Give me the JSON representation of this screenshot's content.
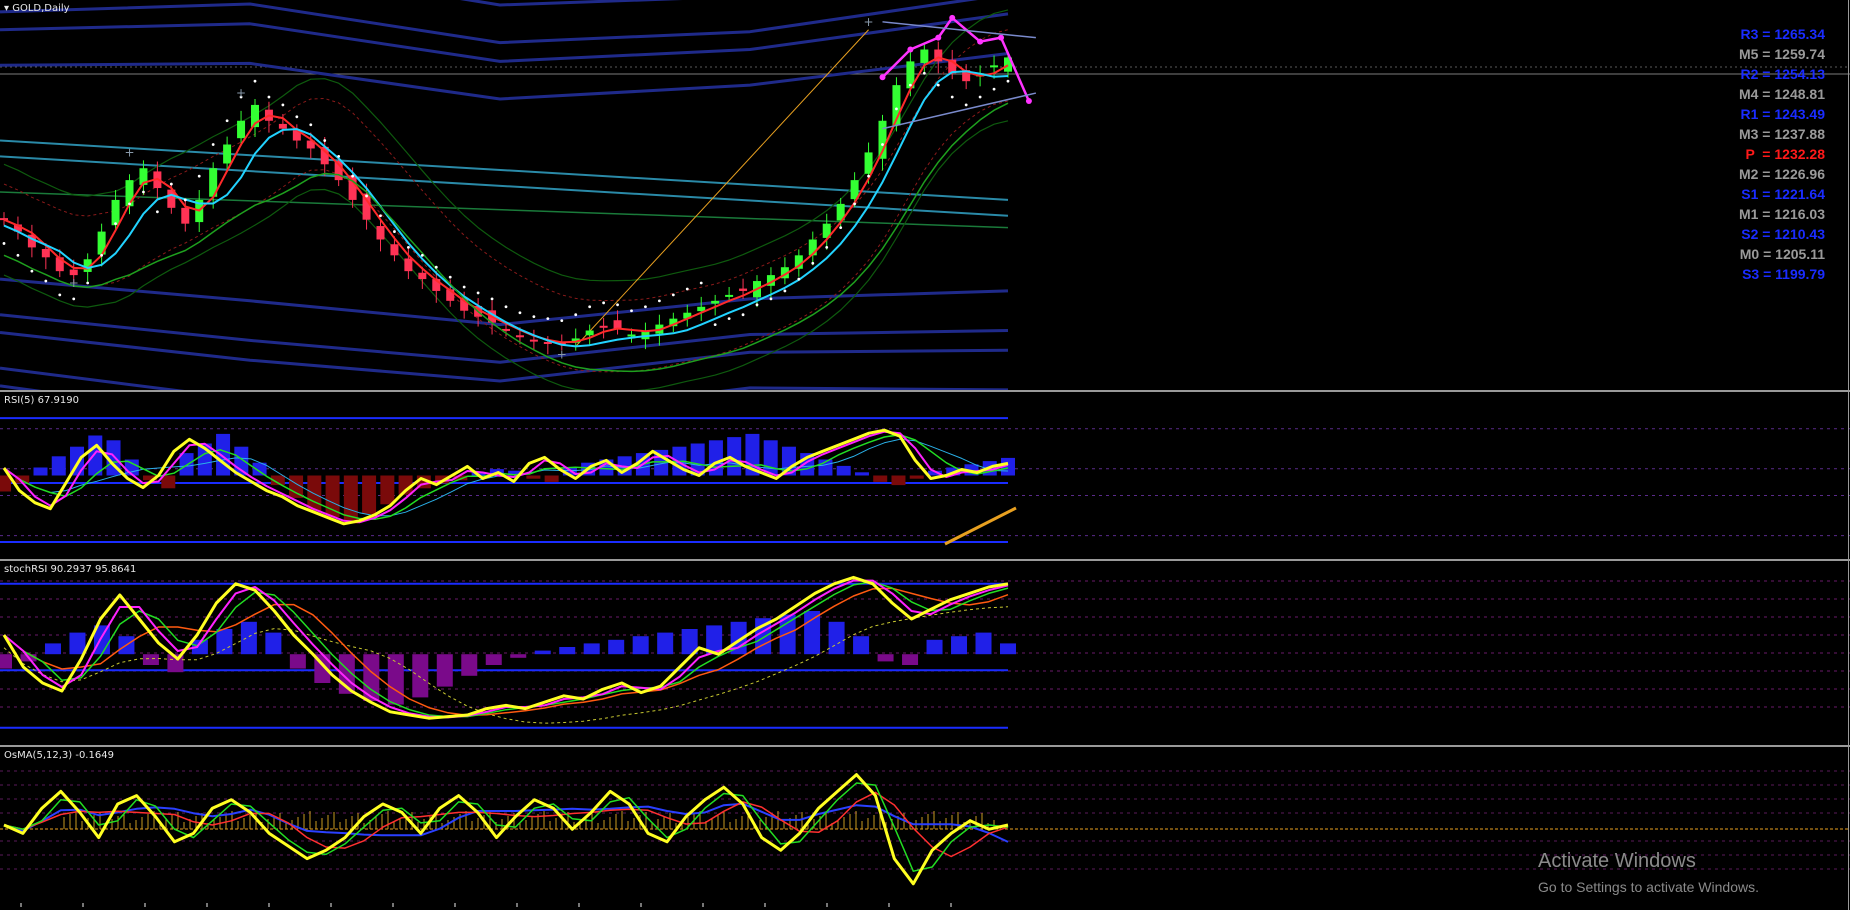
{
  "chart_data": [
    {
      "type": "candlestick",
      "title": "GOLD,Daily",
      "series": [
        {
          "name": "GOLD,Daily",
          "close_trend": [
            1176,
            1170,
            1162,
            1157,
            1150,
            1148,
            1156,
            1170,
            1186,
            1196,
            1202,
            1192,
            1182,
            1174,
            1186,
            1202,
            1214,
            1226,
            1234,
            1226,
            1222,
            1216,
            1212,
            1204,
            1196,
            1186,
            1176,
            1166,
            1158,
            1150,
            1146,
            1140,
            1135,
            1130,
            1127,
            1124,
            1120,
            1117,
            1115,
            1114,
            1113,
            1116,
            1120,
            1122,
            1121,
            1118,
            1120,
            1123,
            1126,
            1129,
            1132,
            1135,
            1138,
            1140,
            1145,
            1148,
            1152,
            1158,
            1166,
            1174,
            1184,
            1196,
            1210,
            1226,
            1244,
            1256,
            1262,
            1256,
            1250,
            1246,
            1250,
            1254,
            1258
          ]
        }
      ],
      "annotations": {
        "pivot_levels": [
          {
            "label": "R3",
            "value": "1265.34",
            "color": "#1a2cff"
          },
          {
            "label": "M5",
            "value": "1259.74",
            "color": "#9a9a9a"
          },
          {
            "label": "R2",
            "value": "1254.13",
            "color": "#1a2cff"
          },
          {
            "label": "M4",
            "value": "1248.81",
            "color": "#9a9a9a"
          },
          {
            "label": "R1",
            "value": "1243.49",
            "color": "#1a2cff"
          },
          {
            "label": "M3",
            "value": "1237.88",
            "color": "#9a9a9a"
          },
          {
            "label": "P",
            "value": "1232.28",
            "color": "#ff1a1a"
          },
          {
            "label": "M2",
            "value": "1226.96",
            "color": "#9a9a9a"
          },
          {
            "label": "S1",
            "value": "1221.64",
            "color": "#1a2cff"
          },
          {
            "label": "M1",
            "value": "1216.03",
            "color": "#9a9a9a"
          },
          {
            "label": "S2",
            "value": "1210.43",
            "color": "#1a2cff"
          },
          {
            "label": "M0",
            "value": "1205.11",
            "color": "#9a9a9a"
          },
          {
            "label": "S3",
            "value": "1199.79",
            "color": "#1a2cff"
          }
        ]
      },
      "colors": {
        "bull": "#33ff33",
        "bear": "#ff3355",
        "ma_fast": "#22d3ff",
        "ma_slow": "#ff2a2a",
        "pattern": "#ff33ff"
      }
    },
    {
      "type": "line",
      "title": "RSI(5) 67.9190",
      "series": [
        {
          "name": "RSI(5)",
          "values": [
            55,
            40,
            32,
            28,
            45,
            62,
            70,
            58,
            48,
            42,
            50,
            66,
            74,
            68,
            60,
            52,
            46,
            40,
            36,
            30,
            26,
            22,
            18,
            20,
            24,
            30,
            40,
            48,
            44,
            50,
            56,
            48,
            52,
            46,
            58,
            62,
            54,
            48,
            56,
            60,
            52,
            58,
            66,
            60,
            54,
            50,
            58,
            62,
            56,
            52,
            48,
            56,
            62,
            66,
            70,
            74,
            78,
            80,
            76,
            60,
            48,
            50,
            54,
            52,
            56,
            58
          ]
        }
      ],
      "histogram": [
        -10,
        -5,
        5,
        12,
        18,
        25,
        22,
        10,
        -3,
        -8,
        14,
        20,
        26,
        18,
        8,
        -6,
        -14,
        -22,
        -26,
        -30,
        -24,
        -18,
        -12,
        -8,
        -5,
        -3,
        2,
        4,
        3,
        -2,
        -4,
        5,
        8,
        10,
        12,
        14,
        16,
        18,
        20,
        22,
        24,
        26,
        22,
        18,
        14,
        10,
        6,
        2,
        -4,
        -6,
        -2,
        3,
        5,
        7,
        9,
        11
      ],
      "ylim": [
        0,
        100
      ]
    },
    {
      "type": "line",
      "title": "stochRSI 90.2937 95.8641",
      "series": [
        {
          "name": "stochRSI",
          "values": [
            60,
            40,
            30,
            25,
            45,
            70,
            85,
            70,
            55,
            45,
            60,
            80,
            92,
            88,
            75,
            60,
            48,
            35,
            25,
            18,
            12,
            10,
            8,
            9,
            10,
            14,
            16,
            14,
            18,
            22,
            20,
            26,
            30,
            24,
            28,
            40,
            52,
            48,
            56,
            64,
            70,
            78,
            86,
            92,
            96,
            92,
            80,
            70,
            76,
            82,
            86,
            90,
            92
          ]
        }
      ],
      "histogram": [
        -8,
        -4,
        6,
        12,
        16,
        10,
        -6,
        -10,
        8,
        14,
        18,
        12,
        -8,
        -16,
        -22,
        -26,
        -28,
        -24,
        -18,
        -12,
        -6,
        -2,
        2,
        4,
        6,
        8,
        10,
        12,
        14,
        16,
        18,
        20,
        22,
        24,
        18,
        10,
        -4,
        -6,
        8,
        10,
        12,
        6
      ],
      "ylim": [
        0,
        100
      ]
    },
    {
      "type": "line",
      "title": "OsMA(5,12,3) -0.1649",
      "series": [
        {
          "name": "OsMA(5,12,3)",
          "values": [
            0,
            -2,
            4,
            8,
            3,
            -3,
            5,
            7,
            2,
            -4,
            -2,
            4,
            6,
            3,
            -2,
            -5,
            -8,
            -6,
            -3,
            2,
            5,
            3,
            -2,
            4,
            7,
            3,
            -3,
            2,
            6,
            4,
            -1,
            3,
            8,
            5,
            -2,
            -4,
            2,
            6,
            9,
            5,
            -3,
            -6,
            -2,
            4,
            8,
            12,
            7,
            -8,
            -14,
            -6,
            -2,
            1,
            -1,
            0
          ]
        }
      ],
      "ylim": [
        -15,
        15
      ]
    }
  ],
  "pane_titles": {
    "main": "GOLD,Daily",
    "rsi": "RSI(5) 67.9190",
    "stoch": "stochRSI 90.2937 95.8641",
    "osma": "OsMA(5,12,3) -0.1649"
  },
  "watermark": {
    "line1": "Activate Windows",
    "line2": "Go to Settings to activate Windows."
  }
}
